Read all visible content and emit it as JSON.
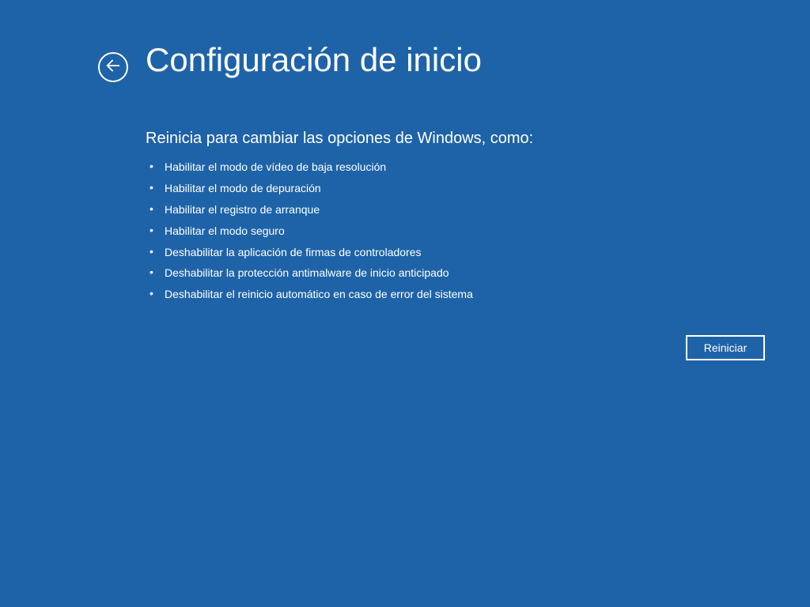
{
  "header": {
    "title": "Configuración de inicio"
  },
  "main": {
    "subtitle": "Reinicia para cambiar las opciones de Windows, como:",
    "options": [
      "Habilitar el modo de vídeo de baja resolución",
      "Habilitar el modo de depuración",
      "Habilitar el registro de arranque",
      "Habilitar el modo seguro",
      "Deshabilitar la aplicación de firmas de controladores",
      "Deshabilitar la protección antimalware de inicio anticipado",
      "Deshabilitar el reinicio automático en caso de error del sistema"
    ]
  },
  "actions": {
    "restart_label": "Reiniciar"
  }
}
